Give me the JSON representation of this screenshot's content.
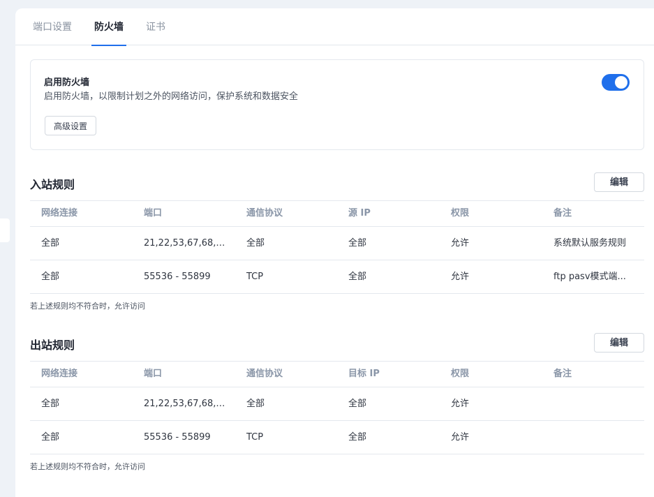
{
  "tabs": [
    {
      "label": "端口设置",
      "active": false
    },
    {
      "label": "防火墙",
      "active": true
    },
    {
      "label": "证书",
      "active": false
    }
  ],
  "firewall": {
    "title": "启用防火墙",
    "description": "启用防火墙，以限制计划之外的网络访问，保护系统和数据安全",
    "advanced_button": "高级设置",
    "enabled": true
  },
  "inbound": {
    "title": "入站规则",
    "edit_button": "编辑",
    "columns": [
      "网络连接",
      "端口",
      "通信协议",
      "源 IP",
      "权限",
      "备注"
    ],
    "rows": [
      [
        "全部",
        "21,22,53,67,68,8...",
        "全部",
        "全部",
        "允许",
        "系统默认服务规则"
      ],
      [
        "全部",
        "55536 - 55899",
        "TCP",
        "全部",
        "允许",
        "ftp pasv模式端..."
      ]
    ],
    "footer_note": "若上述规则均不符合时，允许访问"
  },
  "outbound": {
    "title": "出站规则",
    "edit_button": "编辑",
    "columns": [
      "网络连接",
      "端口",
      "通信协议",
      "目标 IP",
      "权限",
      "备注"
    ],
    "rows": [
      [
        "全部",
        "21,22,53,67,68,8...",
        "全部",
        "全部",
        "允许",
        ""
      ],
      [
        "全部",
        "55536 - 55899",
        "TCP",
        "全部",
        "允许",
        ""
      ]
    ],
    "footer_note": "若上述规则均不符合时，允许访问"
  },
  "colors": {
    "accent": "#1f6feb",
    "background": "#eef2f7",
    "header_text": "#8a96a8"
  }
}
